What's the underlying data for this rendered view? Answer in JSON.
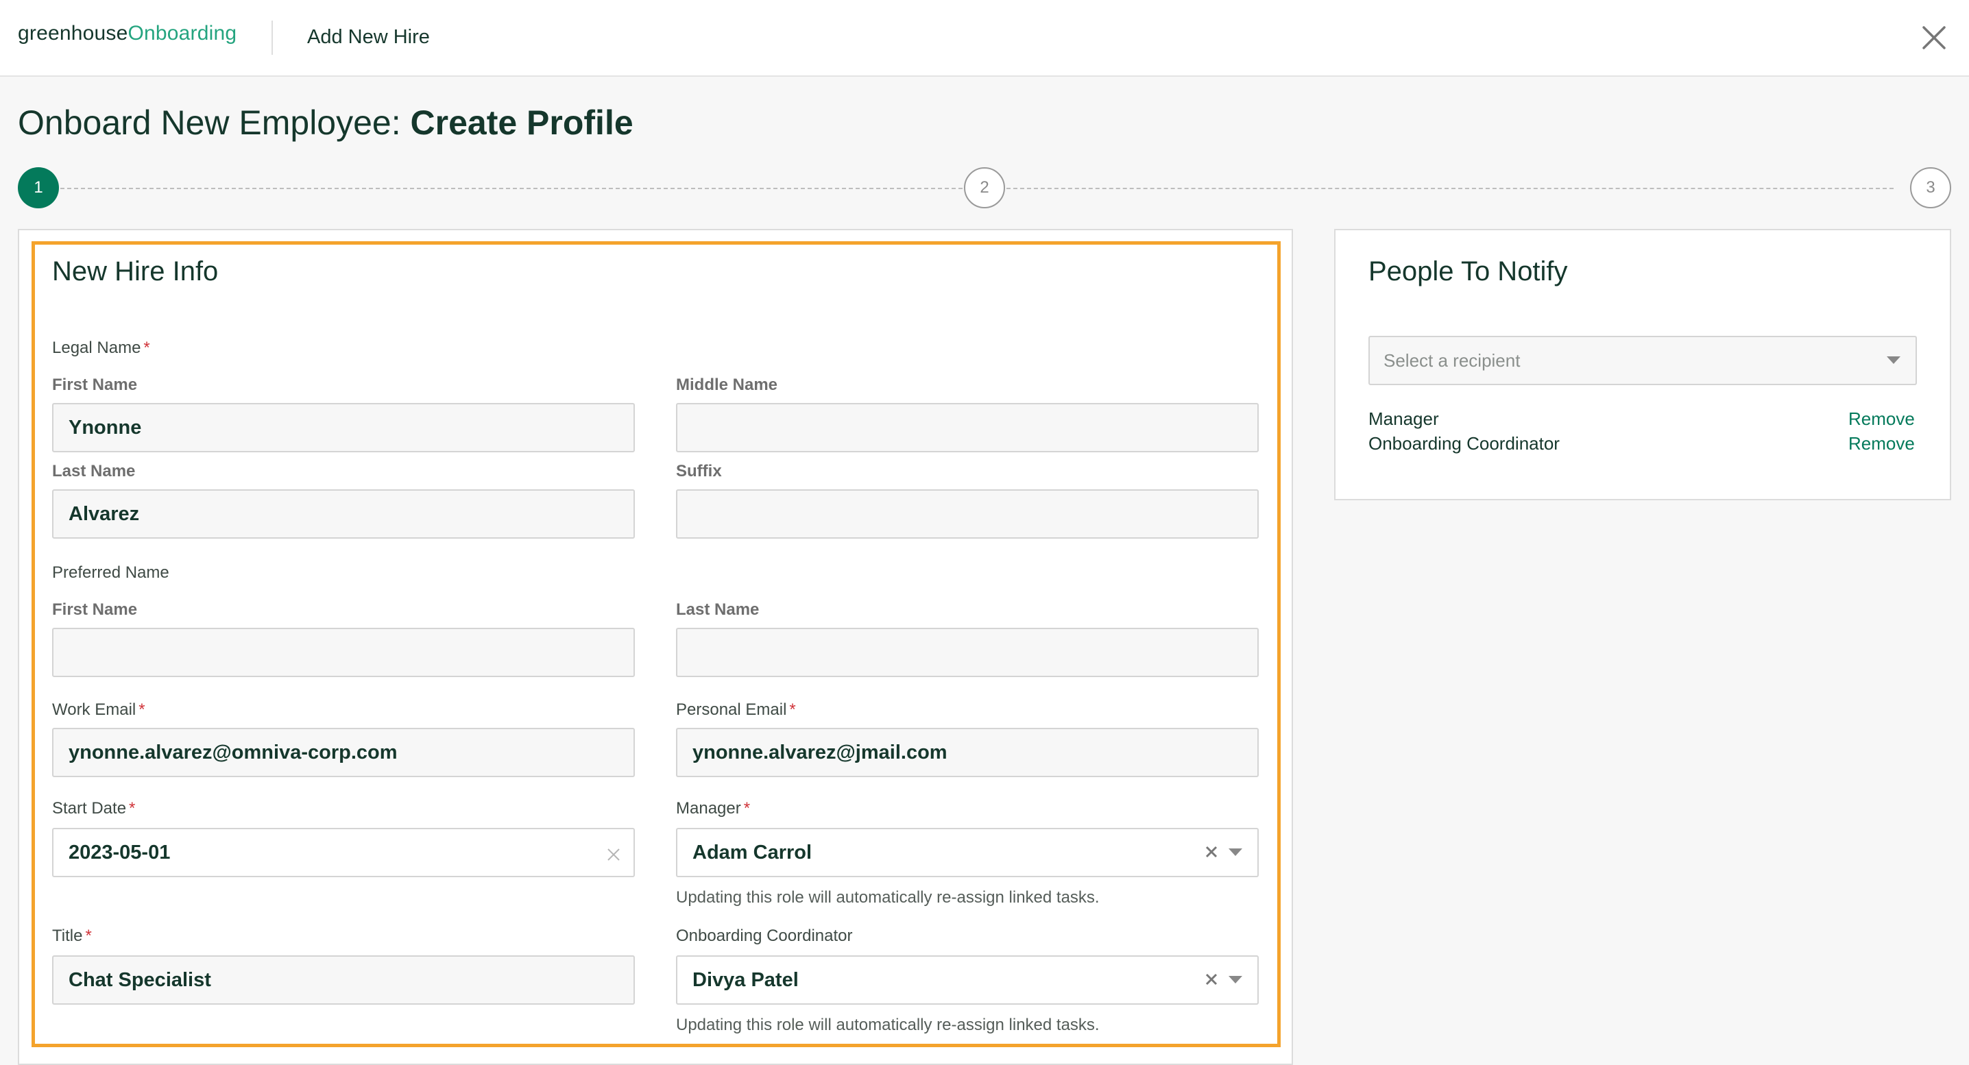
{
  "topbar": {
    "brand_part1": "greenhouse",
    "brand_part2": "Onboarding",
    "title": "Add New Hire",
    "close_icon": "close-icon"
  },
  "page": {
    "title_prefix": "Onboard New Employee: ",
    "title_bold": "Create Profile"
  },
  "stepper": {
    "steps": [
      "1",
      "2",
      "3"
    ],
    "active_step": 1
  },
  "new_hire_info": {
    "title": "New Hire Info",
    "legal_name_label": "Legal Name",
    "first_name_label": "First Name",
    "first_name_value": "Ynonne",
    "middle_name_label": "Middle Name",
    "middle_name_value": "",
    "last_name_label": "Last Name",
    "last_name_value": "Alvarez",
    "suffix_label": "Suffix",
    "suffix_value": "",
    "preferred_name_label": "Preferred Name",
    "pref_first_name_label": "First Name",
    "pref_first_name_value": "",
    "pref_last_name_label": "Last Name",
    "pref_last_name_value": "",
    "work_email_label": "Work Email",
    "work_email_value": "ynonne.alvarez@omniva-corp.com",
    "personal_email_label": "Personal Email",
    "personal_email_value": "ynonne.alvarez@jmail.com",
    "start_date_label": "Start Date",
    "start_date_value": "2023-05-01",
    "manager_label": "Manager",
    "manager_value": "Adam Carrol",
    "manager_helper": "Updating this role will automatically re-assign linked tasks.",
    "title_label": "Title",
    "title_value": "Chat Specialist",
    "coordinator_label": "Onboarding Coordinator",
    "coordinator_value": "Divya Patel",
    "coordinator_helper": "Updating this role will automatically re-assign linked tasks.",
    "required_marker": "*"
  },
  "people_to_notify": {
    "title": "People To Notify",
    "select_placeholder": "Select a recipient",
    "recipients": [
      {
        "role": "Manager",
        "action": "Remove"
      },
      {
        "role": "Onboarding Coordinator",
        "action": "Remove"
      }
    ]
  },
  "colors": {
    "brand_dark": "#15372c",
    "brand_green": "#24a47f",
    "active_step": "#047a5b",
    "highlight": "#f4a32c",
    "required": "#d0343a"
  }
}
